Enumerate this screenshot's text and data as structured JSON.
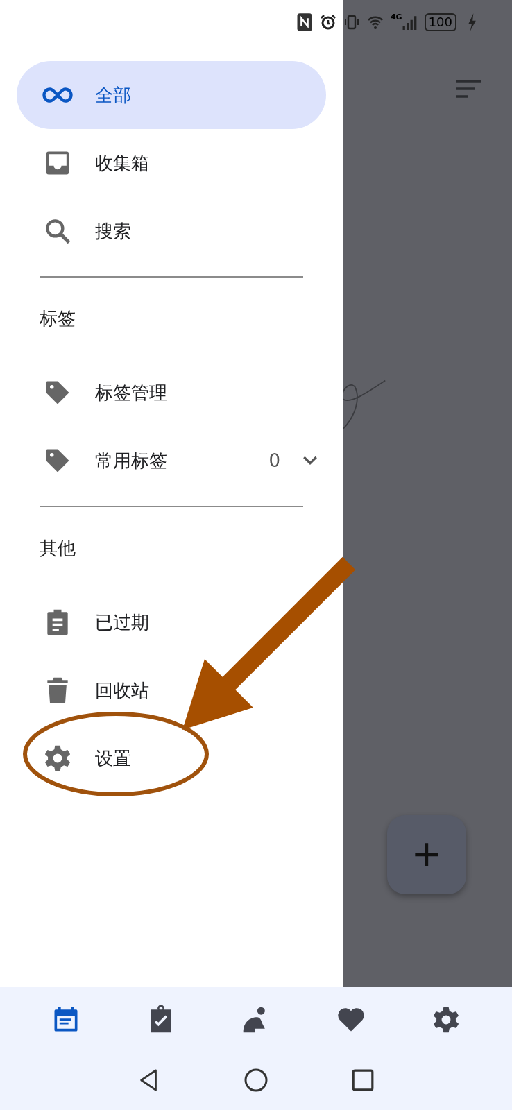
{
  "status_bar": {
    "network": "4G",
    "battery": "100"
  },
  "drawer": {
    "sections": [
      {
        "items": [
          {
            "label": "全部",
            "selected": true
          },
          {
            "label": "收集箱",
            "selected": false
          },
          {
            "label": "搜索",
            "selected": false
          }
        ]
      },
      {
        "title": "标签",
        "items": [
          {
            "label": "标签管理",
            "selected": false
          },
          {
            "label": "常用标签",
            "selected": false,
            "count": "0",
            "expanded": false
          }
        ]
      },
      {
        "title": "其他",
        "items": [
          {
            "label": "已过期",
            "selected": false
          },
          {
            "label": "回收站",
            "selected": false
          },
          {
            "label": "设置",
            "selected": false
          }
        ]
      }
    ]
  },
  "bottom_nav": [
    {
      "selected": true
    },
    {
      "selected": false
    },
    {
      "selected": false
    },
    {
      "selected": false
    },
    {
      "selected": false
    }
  ]
}
